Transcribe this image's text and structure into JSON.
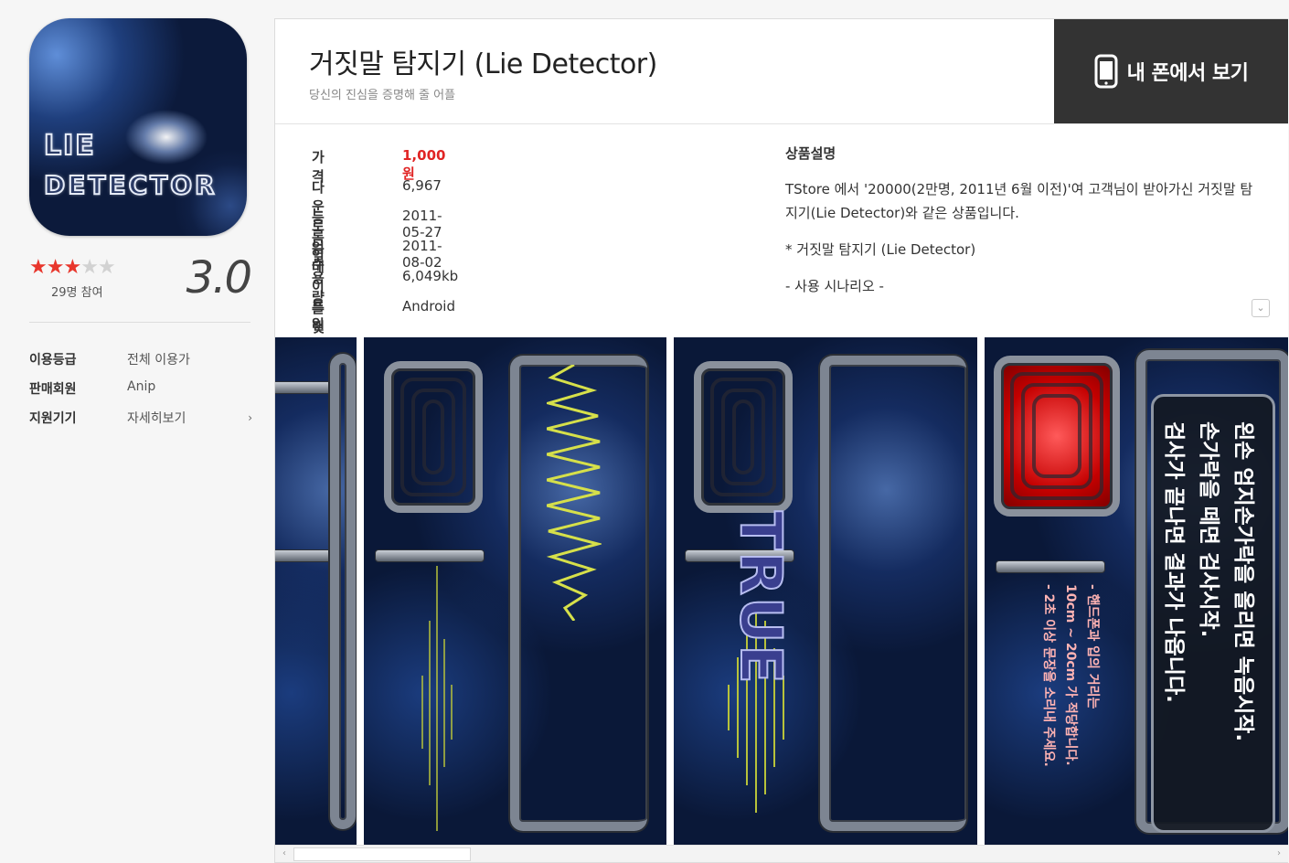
{
  "app": {
    "icon_line1": "LIE",
    "icon_line2": "DETECTOR",
    "rating_stars": 3,
    "rating_max": 5,
    "participants": "29명 참여",
    "score": "3.0"
  },
  "left_info": [
    {
      "key": "이용등급",
      "value": "전체 이용가"
    },
    {
      "key": "판매회원",
      "value": "Anip"
    },
    {
      "key": "지원기기",
      "value": "자세히보기"
    }
  ],
  "header": {
    "title": "거짓말 탐지기 (Lie Detector)",
    "subtitle": "당신의 진심을 증명해 줄 어플",
    "phone_button": "내 폰에서 보기"
  },
  "details": [
    {
      "key": "가격",
      "value": "1,000원"
    },
    {
      "key": "다운로드수",
      "value": "6,967"
    },
    {
      "key": "등록일",
      "value": "2011-05-27"
    },
    {
      "key": "업데이트일",
      "value": "2011-08-02"
    },
    {
      "key": "용량",
      "value": "6,049kb"
    },
    {
      "key": "플랫폼",
      "value": "Android"
    }
  ],
  "description": {
    "heading": "상품설명",
    "p1": "TStore 에서 '20000(2만명, 2011년 6월 이전)'여 고객님이 받아가신 거짓말 탐지기(Lie Detector)와 같은 상품입니다.",
    "p2": "* 거짓말 탐지기 (Lie Detector)",
    "p3": "- 사용 시나리오 -"
  },
  "screenshots": {
    "true_label": "TRUE",
    "msg_lines": [
      "왼손 엄지손가락을 올리면 녹음시작.",
      "손가락을 떼면 검사시작.",
      "검사가 끝나면 결과가 나옵니다."
    ],
    "red_lines": [
      "- 핸드폰과 입의 거리는",
      "10cm ~ 20cm 가 적당합니다.",
      "- 2초 이상 문장을 소리내 주세요."
    ]
  },
  "colors": {
    "price": "#e02424",
    "star_on": "#e8362c",
    "phone_button_bg": "#333333"
  }
}
